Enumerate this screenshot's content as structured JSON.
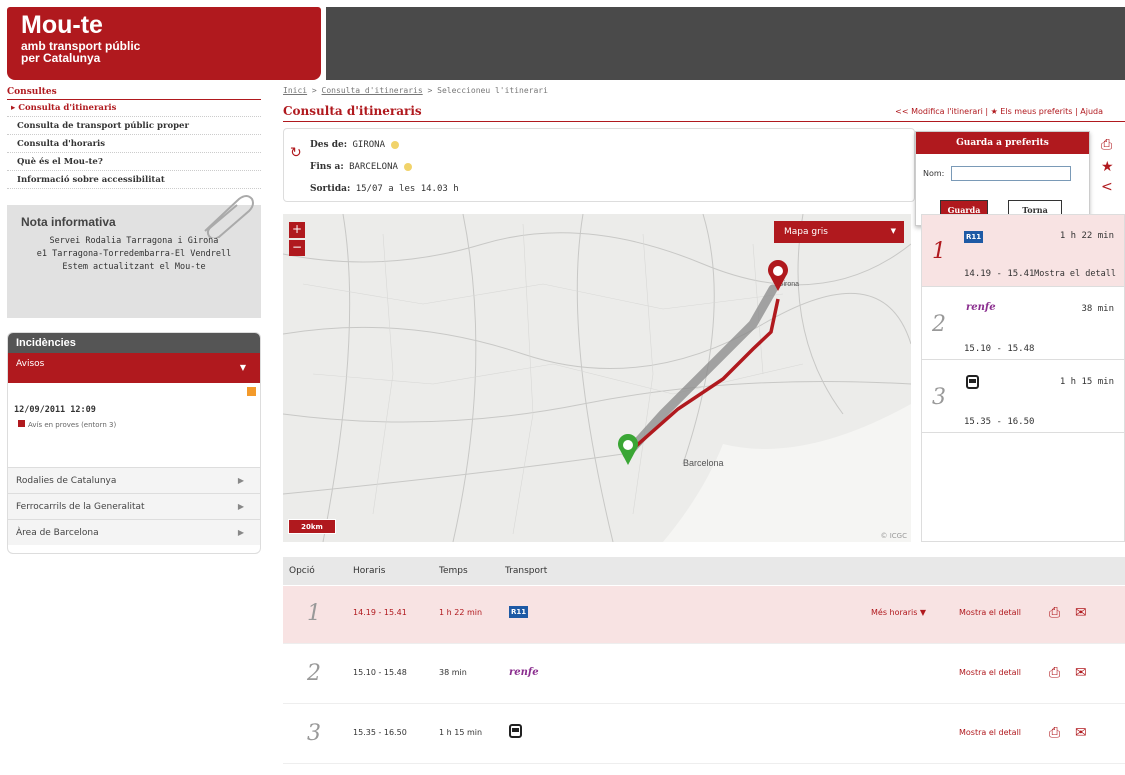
{
  "header": {
    "title": "Mou-te",
    "subtitle1": "amb transport públic",
    "subtitle2": "per Catalunya"
  },
  "sidebar": {
    "title": "Consultes",
    "items": [
      {
        "label": "Consulta d'itineraris"
      },
      {
        "label": "Consulta de transport públic proper"
      },
      {
        "label": "Consulta d'horaris"
      },
      {
        "label": "Què és el Mou-te?"
      },
      {
        "label": "Informació sobre accessibilitat"
      }
    ],
    "nota": {
      "title": "Nota informativa",
      "line1": "Servei Rodalia Tarragona i Girona",
      "line2": "e1 Tarragona-Torredembarra-El Vendrell",
      "line3": "Estem actualitzant el Mou-te"
    },
    "incidencies": {
      "title": "Incidències",
      "avisos": "Avisos",
      "date": "12/09/2011 12:09",
      "notice": "Avís en proves (entorn 3)",
      "rows": [
        "Rodalies de Catalunya",
        "Ferrocarrils de la Generalitat",
        "Àrea de Barcelona"
      ]
    }
  },
  "breadcrumb": {
    "home": "Inici",
    "sep": " > ",
    "middle": "Consulta d'itineraris",
    "current": "Seleccioneu l'itinerari"
  },
  "page_title": "Consulta d'itineraris",
  "toplinks": {
    "modify": "<< Modifica l'itinerari",
    "sep1": " | ",
    "favorites": "★ Els meus preferits",
    "sep2": " | ",
    "help": "Ajuda"
  },
  "route": {
    "from_label": "Des de:",
    "from": "GIRONA",
    "to_label": "Fins a:",
    "to": "BARCELONA",
    "departure_label": "Sortida:",
    "departure": "15/07 a les 14.03 h"
  },
  "prefs": {
    "title": "Guarda a preferits",
    "name_label": "Nom:",
    "name_value": "",
    "save": "Guarda",
    "back": "Torna"
  },
  "map": {
    "layer": "Mapa gris",
    "scale": "20km",
    "place_girona": "Girona",
    "place_barcelona": "Barcelona",
    "copyright": "© ICGC"
  },
  "options": [
    {
      "num": "1",
      "operator": "R11",
      "time": "1 h 22 min",
      "hours": "14.19 - 15.41",
      "detail": "Mostra el detall"
    },
    {
      "num": "2",
      "operator": "renfe",
      "time": "38 min",
      "hours": "15.10 - 15.48"
    },
    {
      "num": "3",
      "operator": "bus",
      "time": "1 h 15 min",
      "hours": "15.35 - 16.50"
    }
  ],
  "table": {
    "headers": [
      "Opció",
      "Horaris",
      "Temps",
      "Transport"
    ],
    "rows": [
      {
        "num": "1",
        "hours": "14.19 - 15.41",
        "time": "1 h 22 min",
        "badge": "R11",
        "more": "Més horaris ▼",
        "detail": "Mostra el detall"
      },
      {
        "num": "2",
        "hours": "15.10 - 15.48",
        "time": "38 min",
        "badge": "renfe",
        "detail": "Mostra el detall"
      },
      {
        "num": "3",
        "hours": "15.35 - 16.50",
        "time": "1 h 15 min",
        "badge": "bus",
        "detail": "Mostra el detall"
      }
    ]
  },
  "colors": {
    "brand": "#b0191e",
    "topbar": "#4a4a4a",
    "selected_bg": "#f8e3e3"
  }
}
